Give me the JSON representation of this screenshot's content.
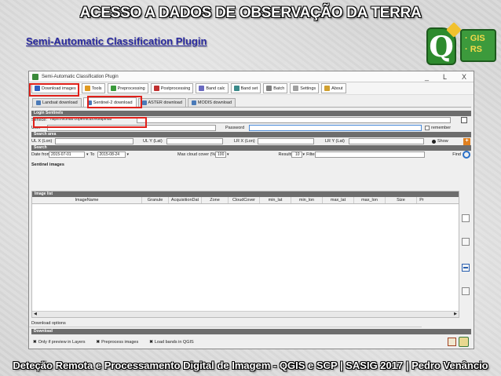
{
  "slide": {
    "title": "ACESSO A DADOS DE OBSERVAÇÃO DA TERRA",
    "subtitle": "Semi-Automatic Classification Plugin",
    "footer": "Deteção Remota e Processamento Digital de Imagem - QGIS e SCP  |  SASIG 2017  |  Pedro Venâncio",
    "logo_q": "Q",
    "logo_line1": "· GIS",
    "logo_line2": "· RS"
  },
  "window": {
    "title": "Semi-Automatic Classification Plugin",
    "controls": {
      "minimize": "_",
      "maximize": "L",
      "close": "X"
    }
  },
  "toolbar": {
    "items": [
      {
        "label": "Download images",
        "color": "#3060c0"
      },
      {
        "label": "Tools",
        "color": "#e09a20"
      },
      {
        "label": "Preprocessing",
        "color": "#3a9a3a"
      },
      {
        "label": "Postprocessing",
        "color": "#c03030"
      },
      {
        "label": "Band calc",
        "color": "#6a6ac0"
      },
      {
        "label": "Band set",
        "color": "#3a8a8a"
      },
      {
        "label": "Batch",
        "color": "#808080"
      },
      {
        "label": "Settings",
        "color": "#a0a0a0"
      },
      {
        "label": "About",
        "color": "#d0a030"
      }
    ]
  },
  "subtabs": [
    "Landsat download",
    "Sentinel-2 download",
    "ASTER download",
    "MODIS download"
  ],
  "login": {
    "section": "Login Sentinels",
    "service_label": "Service",
    "service_value": "https://scihub.copernicus.eu/apihub",
    "user_label": "User",
    "password_label": "Password",
    "remember_label": "remember"
  },
  "search_area": {
    "section": "Search area",
    "ulx": "UL X (Lon)",
    "uly": "UL Y (Lat)",
    "lrx": "LR X (Lon)",
    "lry": "LR Y (Lat)",
    "show": "Show"
  },
  "search": {
    "section": "Search",
    "date_from_label": "Date from",
    "date_from": "2015-07-01",
    "to_label": "To",
    "date_to": "2015-08-24",
    "cloud_label": "Max cloud cover (%)",
    "cloud_value": "100",
    "results_label": "Results",
    "results_value": "10",
    "filter_label": "Filter",
    "find_label": "Find"
  },
  "sentinel_images": {
    "section": "Sentinel images",
    "image_list_label": "Image list",
    "columns": [
      "ImageName",
      "Granule",
      "AcquisitionDat",
      "Zone",
      "CloudCover",
      "min_lat",
      "min_lon",
      "max_lat",
      "max_lon",
      "Size",
      "Pr"
    ]
  },
  "download_options": {
    "label": "Download options"
  },
  "download": {
    "section": "Download",
    "only_preview": "Only if preview in Layers",
    "preprocess": "Preprocess images",
    "load_bands": "Load bands in QGIS"
  }
}
